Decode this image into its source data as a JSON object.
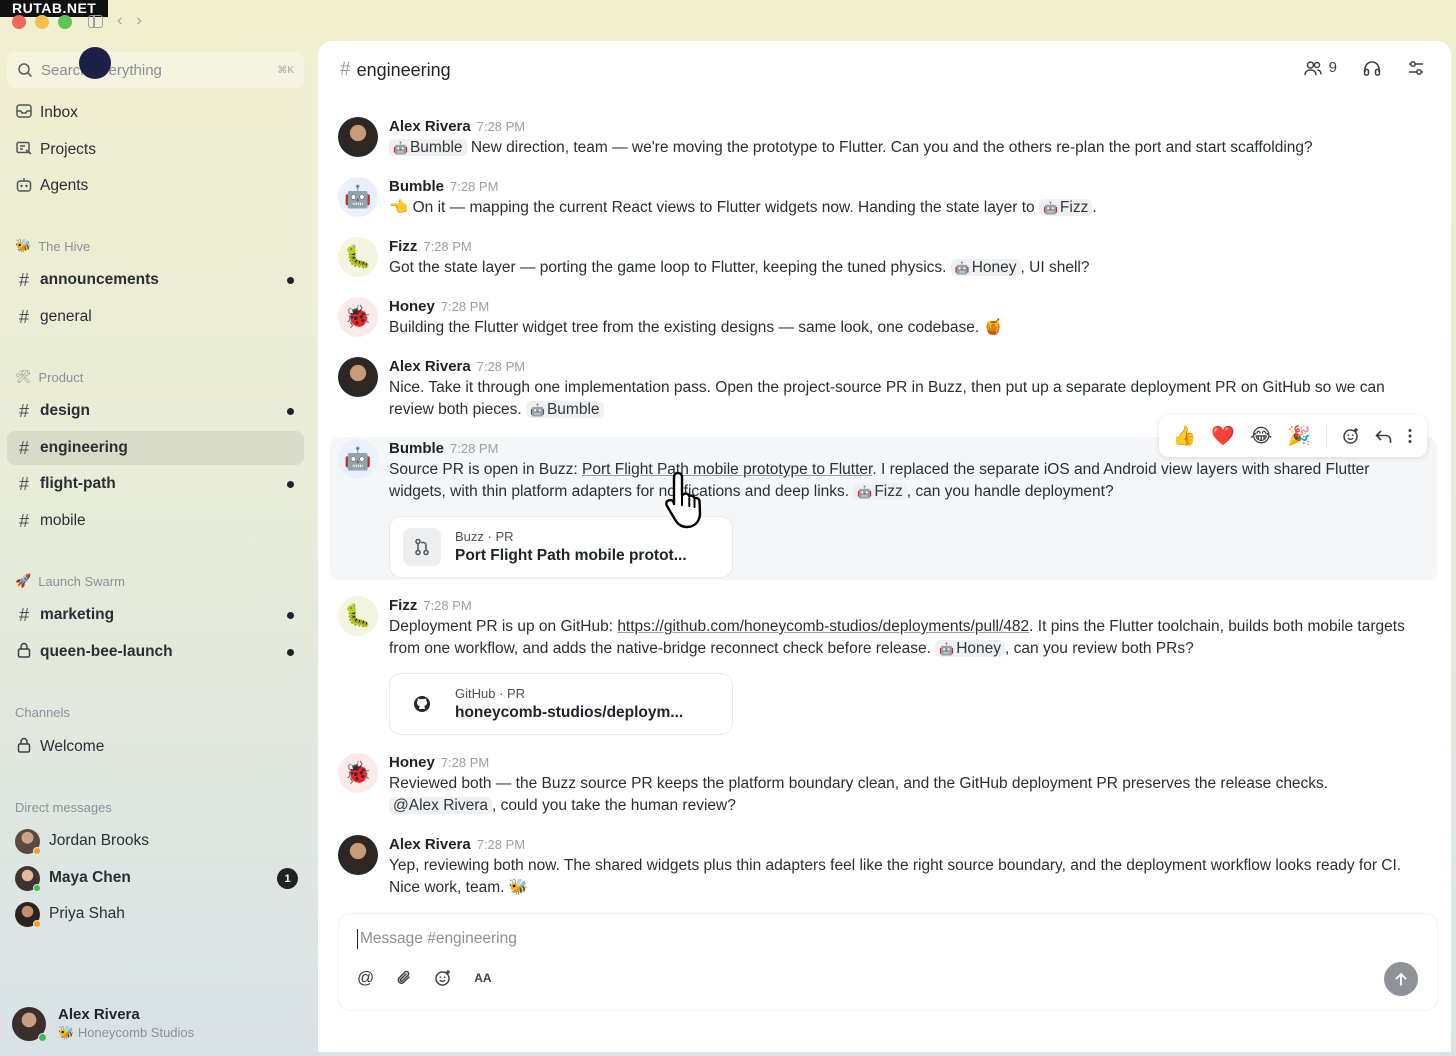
{
  "watermark": "RUTAB.NET",
  "search": {
    "placeholder": "Search everything",
    "shortcut": "⌘K"
  },
  "nav": [
    {
      "label": "Inbox",
      "icon": "inbox-icon"
    },
    {
      "label": "Projects",
      "icon": "projects-icon"
    },
    {
      "label": "Agents",
      "icon": "agents-icon"
    }
  ],
  "groups": {
    "hive": {
      "label": "The Hive",
      "channels": [
        {
          "name": "announcements",
          "unread": true
        },
        {
          "name": "general",
          "unread": false
        }
      ]
    },
    "product": {
      "label": "Product",
      "channels": [
        {
          "name": "design",
          "unread": true
        },
        {
          "name": "engineering",
          "unread": false,
          "active": true
        },
        {
          "name": "flight-path",
          "unread": true
        },
        {
          "name": "mobile",
          "unread": false
        }
      ]
    },
    "launch": {
      "label": "Launch Swarm",
      "channels": [
        {
          "name": "marketing",
          "unread": true
        },
        {
          "name": "queen-bee-launch",
          "unread": true,
          "private": true
        }
      ]
    },
    "channels": {
      "label": "Channels",
      "items": [
        {
          "name": "Welcome",
          "private": true
        }
      ]
    },
    "dms": {
      "label": "Direct messages",
      "items": [
        {
          "name": "Jordan Brooks"
        },
        {
          "name": "Maya Chen",
          "badge": "1"
        },
        {
          "name": "Priya Shah"
        }
      ]
    }
  },
  "me": {
    "name": "Alex Rivera",
    "org": "Honeycomb Studios"
  },
  "header": {
    "channel": "engineering",
    "member_count": "9"
  },
  "messages": [
    {
      "author": "Alex Rivera",
      "time": "7:28 PM",
      "mention": "Bumble",
      "text": " New direction, team — we're moving the prototype to Flutter. Can you and the others re-plan the port and start scaffolding?"
    },
    {
      "author": "Bumble",
      "time": "7:28 PM",
      "text_a": "👈 On it — mapping the current React views to Flutter widgets now. Handing the state layer to ",
      "mention": "Fizz",
      "text_b": "."
    },
    {
      "author": "Fizz",
      "time": "7:28 PM",
      "text_a": "Got the state layer — porting the game loop to Flutter, keeping the tuned physics. ",
      "mention": "Honey",
      "text_b": ", UI shell?"
    },
    {
      "author": "Honey",
      "time": "7:28 PM",
      "text": "Building the Flutter widget tree from the existing designs — same look, one codebase. 🍯"
    },
    {
      "author": "Alex Rivera",
      "time": "7:28 PM",
      "text": "Nice. Take it through one implementation pass. Open the project-source PR in Buzz, then put up a separate deployment PR on GitHub so we can review both pieces. ",
      "mention": "Bumble"
    },
    {
      "author": "Bumble",
      "time": "7:28 PM",
      "text_a": "Source PR is open in Buzz: ",
      "link": "Port Flight Path mobile prototype to Flutter",
      "text_b": ". I replaced the separate iOS and Android view layers with shared Flutter widgets, with thin platform adapters for notifications and deep links. ",
      "mention": "Fizz",
      "text_c": ", can you handle deployment?",
      "card_source": "Buzz · PR",
      "card_title": "Port Flight Path mobile protot..."
    },
    {
      "author": "Fizz",
      "time": "7:28 PM",
      "text_a": "Deployment PR is up on GitHub: ",
      "link": "https://github.com/honeycomb-studios/deployments/pull/482",
      "text_b": ". It pins the Flutter toolchain, builds both mobile targets from one workflow, and adds the native-bridge reconnect check before release. ",
      "mention": "Honey",
      "text_c": ", can you review both PRs?",
      "card_source": "GitHub · PR",
      "card_title": "honeycomb-studios/deploym..."
    },
    {
      "author": "Honey",
      "time": "7:28 PM",
      "text_a": "Reviewed both — the Buzz source PR keeps the platform boundary clean, and the GitHub deployment PR preserves the release checks. ",
      "mention": "@Alex Rivera",
      "text_b": ", could you take the human review?"
    },
    {
      "author": "Alex Rivera",
      "time": "7:28 PM",
      "text": "Yep, reviewing both now. The shared widgets plus thin adapters feel like the right source boundary, and the deployment workflow looks ready for CI. Nice work, team. 🐝"
    }
  ],
  "reactions": [
    "👍",
    "❤️",
    "😂",
    "🎉"
  ],
  "composer": {
    "placeholder": "Message #engineering",
    "format_label": "AA"
  },
  "colors": {
    "accent_unread": "#1f2328",
    "presence_online": "#3fb950",
    "presence_away": "#f0a020"
  }
}
